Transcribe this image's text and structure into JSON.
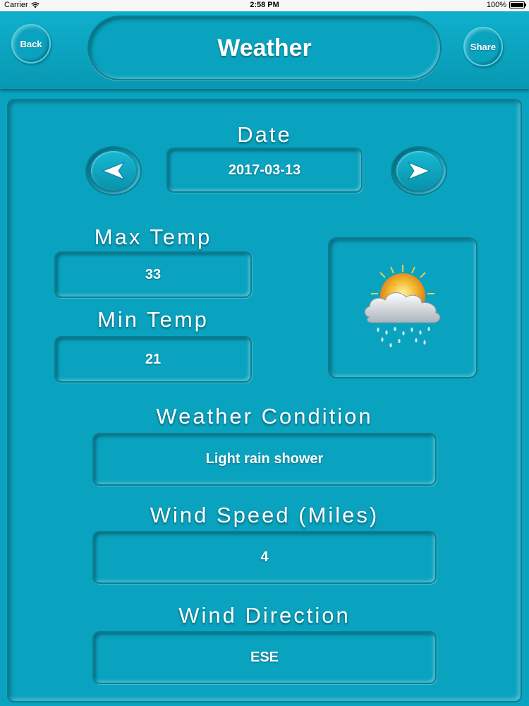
{
  "status_bar": {
    "carrier": "Carrier",
    "time": "2:58 PM",
    "battery": "100%"
  },
  "header": {
    "back_label": "Back",
    "title": "Weather",
    "share_label": "Share"
  },
  "date": {
    "label": "Date",
    "value": "2017-03-13"
  },
  "max_temp": {
    "label": "Max Temp",
    "value": "33"
  },
  "min_temp": {
    "label": "Min Temp",
    "value": "21"
  },
  "weather_icon": "sun-cloud-rain-icon",
  "condition": {
    "label": "Weather Condition",
    "value": "Light rain shower"
  },
  "wind_speed": {
    "label": "Wind Speed (Miles)",
    "value": "4"
  },
  "wind_direction": {
    "label": "Wind Direction",
    "value": "ESE"
  },
  "colors": {
    "background": "#0aa3bf",
    "text": "#ffffff"
  }
}
